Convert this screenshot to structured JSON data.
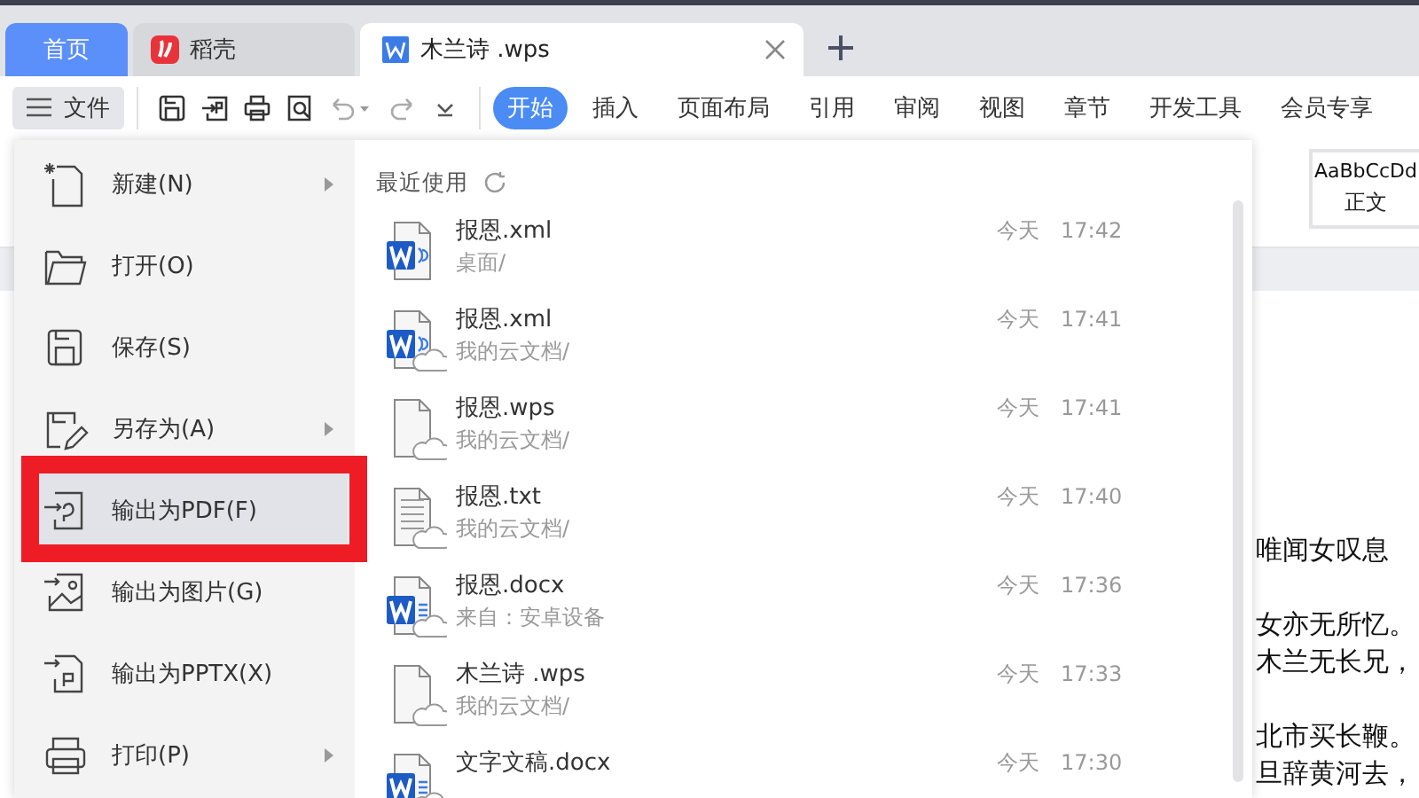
{
  "top_tabs": [
    {
      "kind": "home",
      "label": "首页",
      "selected": false
    },
    {
      "kind": "docer",
      "label": "稻壳",
      "selected": false
    },
    {
      "kind": "document",
      "label": "木兰诗 .wps",
      "selected": true
    }
  ],
  "toolbar": {
    "file_button": "文件",
    "ribbon_tabs": [
      {
        "label": "开始",
        "selected": true
      },
      {
        "label": "插入",
        "selected": false
      },
      {
        "label": "页面布局",
        "selected": false
      },
      {
        "label": "引用",
        "selected": false
      },
      {
        "label": "审阅",
        "selected": false
      },
      {
        "label": "视图",
        "selected": false
      },
      {
        "label": "章节",
        "selected": false
      },
      {
        "label": "开发工具",
        "selected": false
      },
      {
        "label": "会员专享",
        "selected": false
      }
    ]
  },
  "file_menu": {
    "items": [
      {
        "kind": "new",
        "label": "新建(N)",
        "submenu": true,
        "selected": false,
        "highlighted": false
      },
      {
        "kind": "open",
        "label": "打开(O)",
        "submenu": false,
        "selected": false,
        "highlighted": false
      },
      {
        "kind": "save",
        "label": "保存(S)",
        "submenu": false,
        "selected": false,
        "highlighted": false
      },
      {
        "kind": "saveas",
        "label": "另存为(A)",
        "submenu": true,
        "selected": false,
        "highlighted": false
      },
      {
        "kind": "pdf",
        "label": "输出为PDF(F)",
        "submenu": false,
        "selected": true,
        "highlighted": true
      },
      {
        "kind": "image",
        "label": "输出为图片(G)",
        "submenu": false,
        "selected": false,
        "highlighted": false
      },
      {
        "kind": "pptx",
        "label": "输出为PPTX(X)",
        "submenu": false,
        "selected": false,
        "highlighted": false
      },
      {
        "kind": "print",
        "label": "打印(P)",
        "submenu": true,
        "selected": false,
        "highlighted": false
      }
    ]
  },
  "recent": {
    "title": "最近使用",
    "files": [
      {
        "kind": "xml",
        "cloud": false,
        "name": "报恩.xml",
        "path": "桌面/",
        "day": "今天",
        "time": "17:42"
      },
      {
        "kind": "xml",
        "cloud": true,
        "name": "报恩.xml",
        "path": "我的云文档/",
        "day": "今天",
        "time": "17:41"
      },
      {
        "kind": "wps",
        "cloud": true,
        "name": "报恩.wps",
        "path": "我的云文档/",
        "day": "今天",
        "time": "17:41"
      },
      {
        "kind": "txt",
        "cloud": true,
        "name": "报恩.txt",
        "path": "我的云文档/",
        "day": "今天",
        "time": "17:40"
      },
      {
        "kind": "docx",
        "cloud": true,
        "name": "报恩.docx",
        "path": "来自：安卓设备",
        "day": "今天",
        "time": "17:36"
      },
      {
        "kind": "wps",
        "cloud": true,
        "name": "木兰诗 .wps",
        "path": "我的云文档/",
        "day": "今天",
        "time": "17:33"
      },
      {
        "kind": "docx",
        "cloud": true,
        "name": "文字文稿.docx",
        "day": "今天",
        "time": "17:30"
      }
    ]
  },
  "ribbon": {
    "style_preview": "AaBbCcDd",
    "style_name": "正文"
  },
  "document": {
    "paragraphs": [
      {
        "lines": [
          "唯闻女叹息"
        ]
      },
      {
        "lines": [
          "女亦无所忆。",
          "木兰无长兄，"
        ]
      },
      {
        "lines": [
          "北市买长鞭。",
          "旦辞黄河去，"
        ]
      }
    ]
  }
}
